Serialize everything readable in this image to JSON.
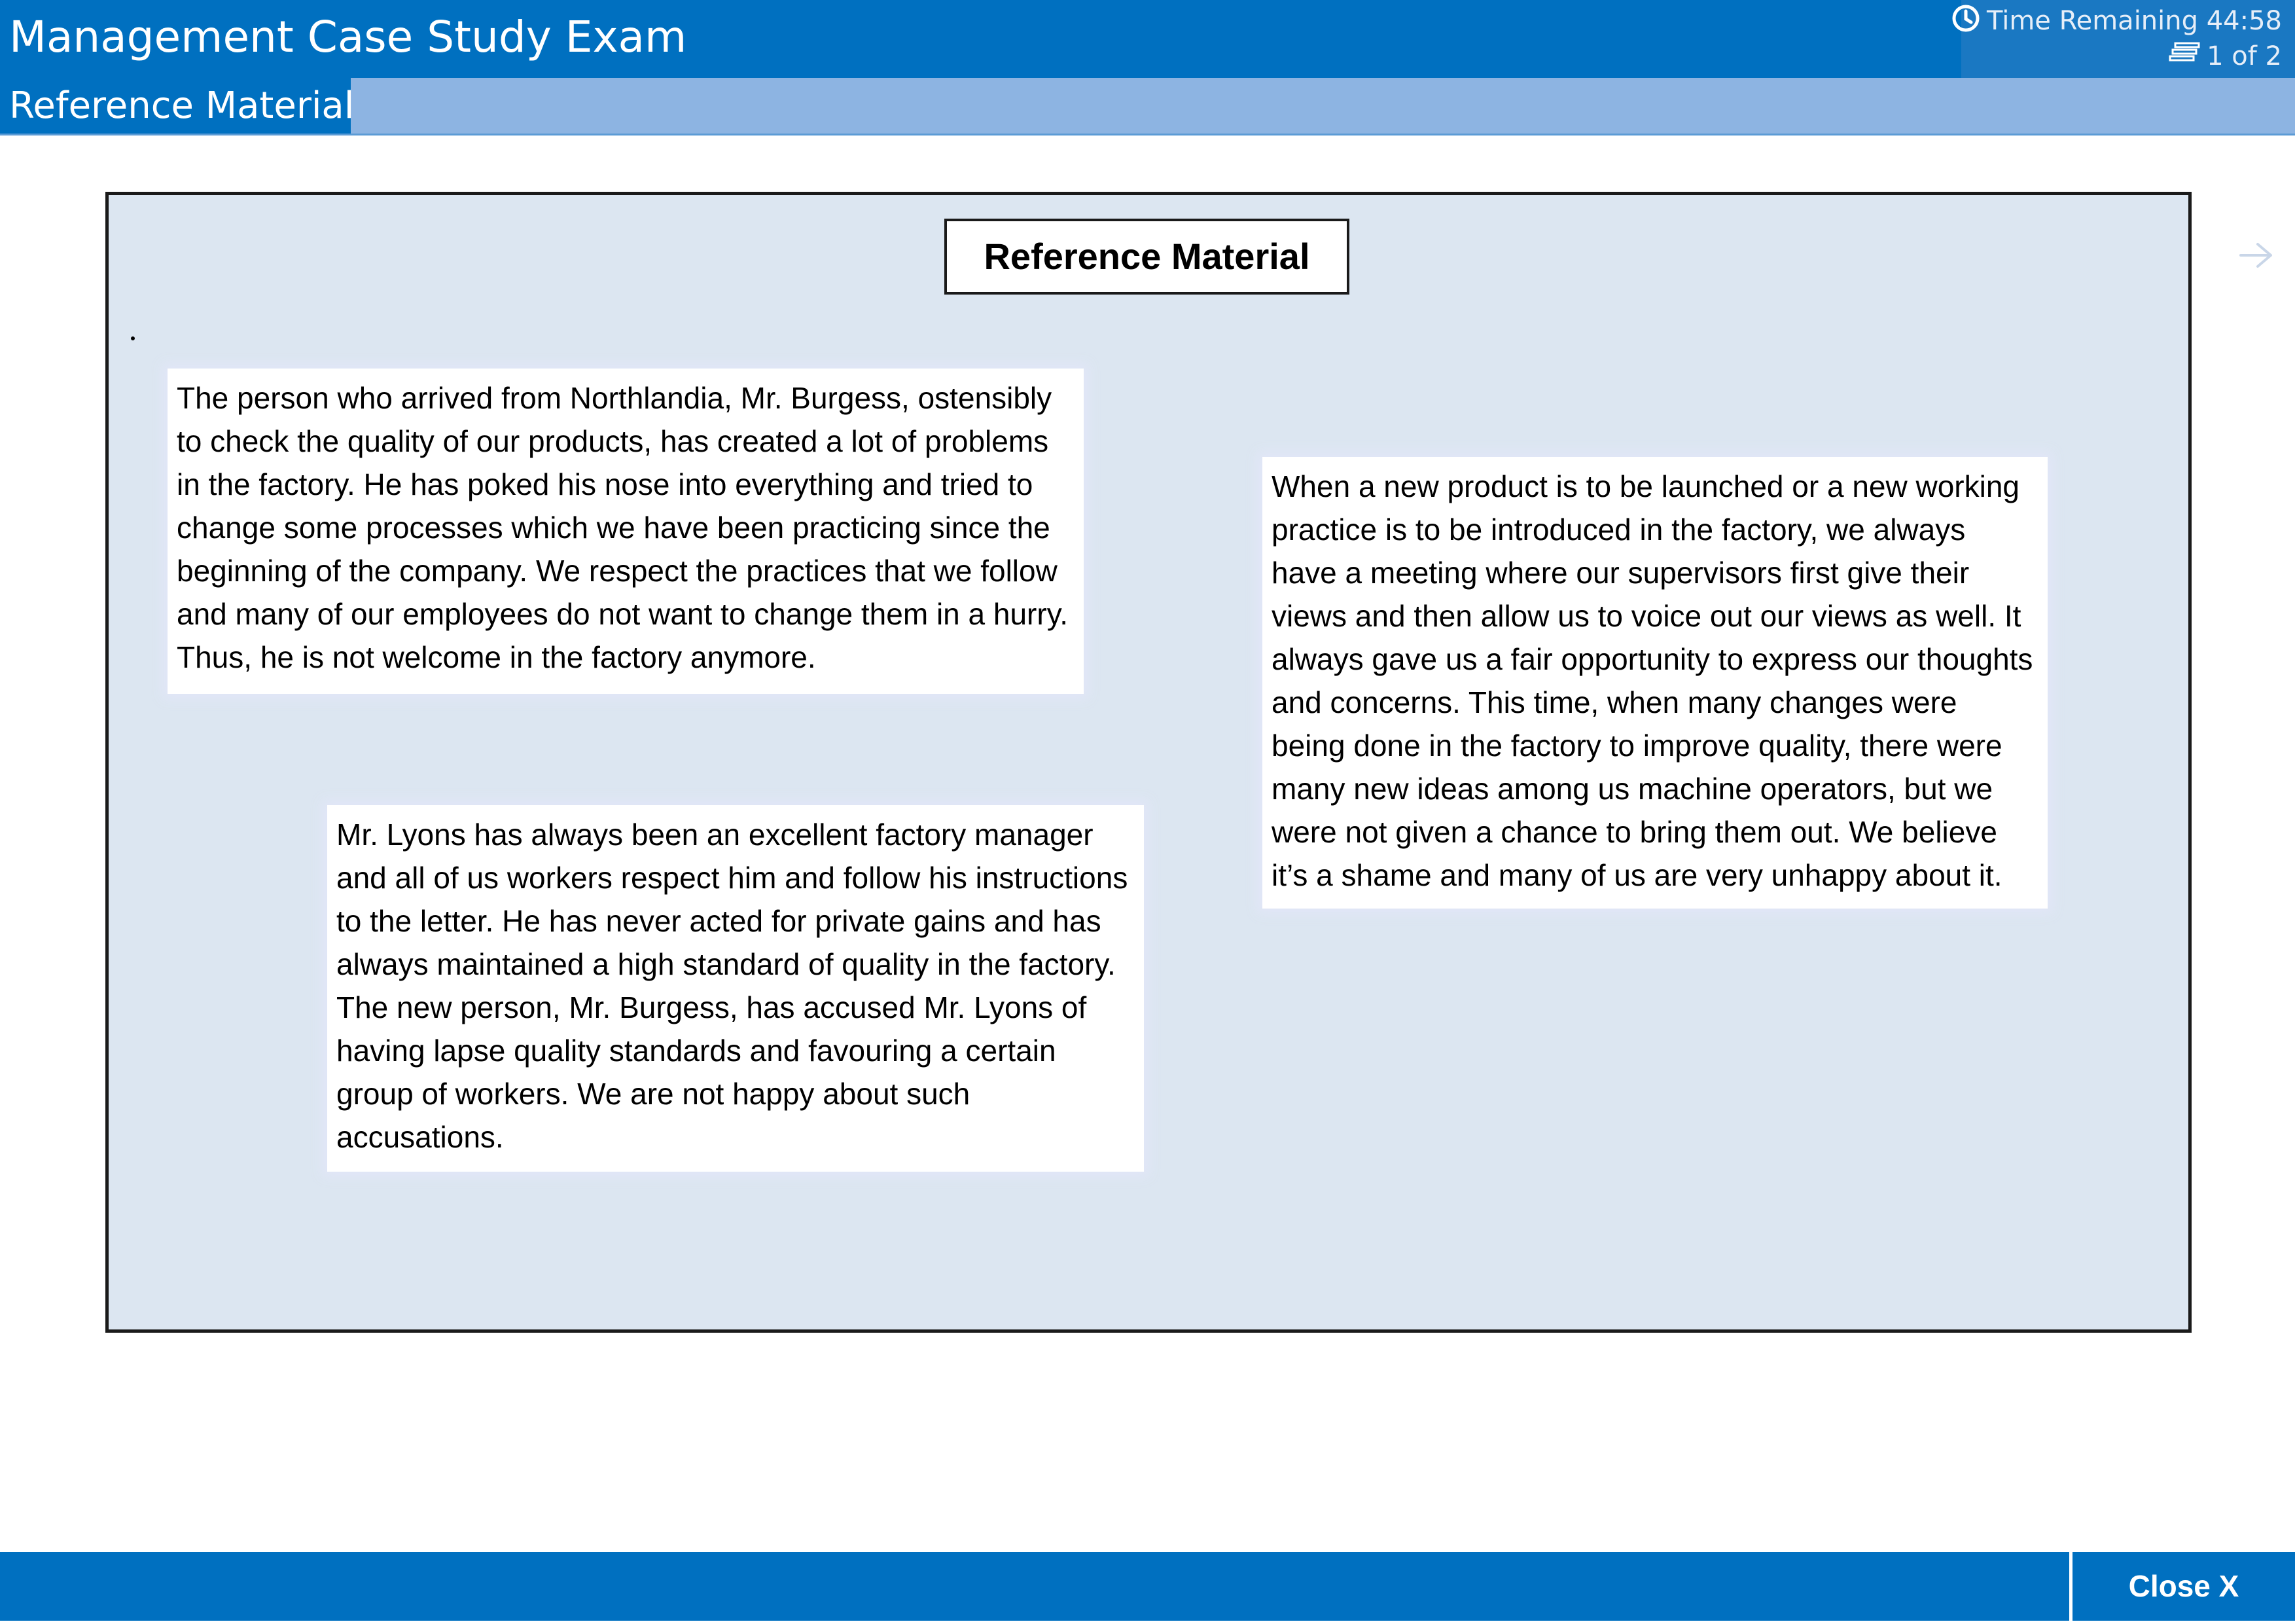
{
  "app": {
    "title": "Management Case Study Exam",
    "time_remaining": "Time Remaining 44:58",
    "page_indicator": "1 of 2"
  },
  "section_tab": "Reference Material",
  "panel": {
    "heading": "Reference Material",
    "cards": [
      {
        "text": "The person who arrived from Northlandia, Mr. Burgess, ostensibly to check the quality of our products, has created a lot of problems in the factory. He has poked his nose into everything and tried to change some processes which we have been practicing since the beginning of the company. We respect the practices that we follow and many of our employees do not want to change them in a hurry. Thus, he is not welcome in the factory anymore."
      },
      {
        "text": "When a new product is to be launched or a new working practice is to be introduced in the factory, we always have a meeting where our supervisors first give their views and then allow us to voice out our views as well. It always gave us a fair opportunity to express our thoughts and concerns. This time, when many changes were being done in the factory to improve quality, there were many new ideas among us machine operators, but we were not given a chance to bring them out. We believe it’s a shame and many of us are very unhappy about it."
      },
      {
        "text": "Mr. Lyons has always been an excellent factory manager and all of us workers respect him and follow his instructions to the letter. He has never acted for private gains and has always maintained a high standard of quality in the factory. The new person, Mr. Burgess, has accused Mr. Lyons of having lapse quality standards and favouring a certain group of workers. We are not happy about such accusations."
      }
    ]
  },
  "footer": {
    "close_label": "Close X"
  },
  "icons": {
    "timer": "clock-icon",
    "pager": "page-stack-icon",
    "next": "next-arrow-icon"
  },
  "colors": {
    "header_blue": "#0070c0",
    "subbar_blue": "#8db4e2",
    "panel_bg": "#dce6f1"
  }
}
